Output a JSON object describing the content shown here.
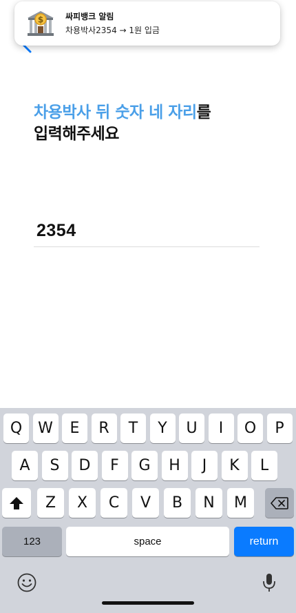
{
  "notification": {
    "app_name": "싸피뱅크 알림",
    "message": "차용박사2354 → 1원 입금",
    "icon": "bank-icon"
  },
  "nav": {
    "back_icon": "chevron-left-icon"
  },
  "heading": {
    "highlight": "차용박사 뒤 숫자 네 자리",
    "suffix": "를",
    "line2": "입력해주세요"
  },
  "code_input": {
    "value": "2354"
  },
  "keyboard": {
    "row1": [
      "Q",
      "W",
      "E",
      "R",
      "T",
      "Y",
      "U",
      "I",
      "O",
      "P"
    ],
    "row2": [
      "A",
      "S",
      "D",
      "F",
      "G",
      "H",
      "J",
      "K",
      "L"
    ],
    "row3": [
      "Z",
      "X",
      "C",
      "V",
      "B",
      "N",
      "M"
    ],
    "numbers_label": "123",
    "space_label": "space",
    "return_label": "return",
    "shift_icon": "shift-icon",
    "delete_icon": "delete-icon",
    "emoji_icon": "emoji-icon",
    "mic_icon": "microphone-icon",
    "accent_color": "#0a7bff"
  },
  "colors": {
    "highlight": "#4a9fe8"
  }
}
